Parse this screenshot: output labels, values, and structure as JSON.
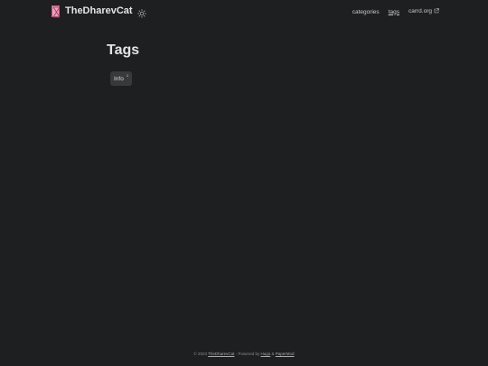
{
  "header": {
    "site_title": "TheDharevCat",
    "nav": [
      {
        "label": "categories",
        "active": false
      },
      {
        "label": "tags",
        "active": true
      },
      {
        "label": "carrd.org",
        "active": false
      }
    ]
  },
  "main": {
    "title": "Tags",
    "tags": [
      {
        "label": "Info",
        "count": "1"
      }
    ]
  },
  "footer": {
    "copyright": "© 2023",
    "site_link": "TheDharevCat",
    "powered_by": "· Powered by",
    "hugo": "Hugo",
    "amp": "&",
    "papermod": "PaperMod"
  },
  "colors": {
    "background": "#1e1f21",
    "text": "#dadadb",
    "tag_bg": "#38393b"
  },
  "icons": {
    "logo": "logo-icon",
    "theme": "sun-icon",
    "external": "external-link-icon"
  }
}
